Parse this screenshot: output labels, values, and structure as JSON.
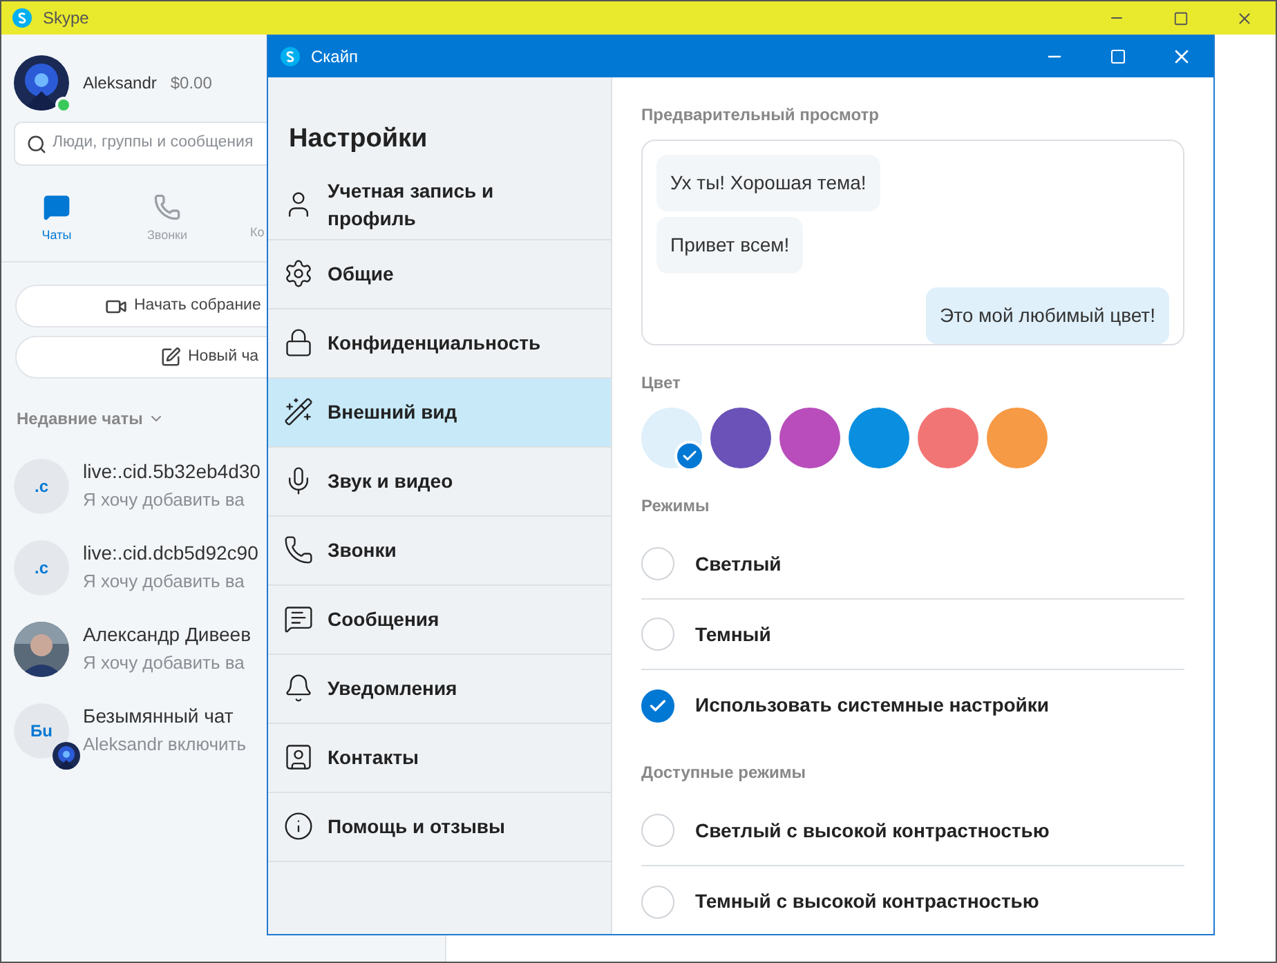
{
  "main_window": {
    "title": "Skype",
    "profile": {
      "name": "Aleksandr",
      "balance": "$0.00",
      "online": true
    },
    "search": {
      "placeholder": "Люди, группы и сообщения"
    },
    "tabs": [
      {
        "label": "Чаты",
        "selected": true
      },
      {
        "label": "Звонки",
        "selected": false
      },
      {
        "label": "Ко",
        "selected": false
      }
    ],
    "actions": [
      "Начать собрание",
      "Новый ча"
    ],
    "recent_header": "Недавние чаты",
    "chats": [
      {
        "kind": "initials",
        "initials": ".c",
        "name": "live:.cid.5b32eb4d30",
        "preview": "Я хочу добавить ва"
      },
      {
        "kind": "initials",
        "initials": ".c",
        "name": "live:.cid.dcb5d92c90",
        "preview": "Я хочу добавить ва"
      },
      {
        "kind": "picture",
        "name": "Александр Дивеев",
        "preview": "Я хочу добавить ва"
      },
      {
        "kind": "group",
        "initials": "Бu",
        "name": "Безымянный чат",
        "preview": "Aleksandr включить"
      }
    ]
  },
  "dialog": {
    "title": "Скайп",
    "heading": "Настройки",
    "nav": [
      {
        "label": "Учетная запись и профиль",
        "selected": false
      },
      {
        "label": "Общие",
        "selected": false
      },
      {
        "label": "Конфиденциальность",
        "selected": false
      },
      {
        "label": "Внешний вид",
        "selected": true
      },
      {
        "label": "Звук и видео",
        "selected": false
      },
      {
        "label": "Звонки",
        "selected": false
      },
      {
        "label": "Сообщения",
        "selected": false
      },
      {
        "label": "Уведомления",
        "selected": false
      },
      {
        "label": "Контакты",
        "selected": false
      },
      {
        "label": "Помощь и отзывы",
        "selected": false
      }
    ],
    "preview_header": "Предварительный просмотр",
    "messages": [
      {
        "text": "Ух ты! Хорошая тема!",
        "outgoing": false
      },
      {
        "text": "Привет всем!",
        "outgoing": false
      },
      {
        "text": "Это мой любимый цвет!",
        "outgoing": true
      }
    ],
    "color_header": "Цвет",
    "colors": [
      {
        "color": "#dff0fb",
        "selected": true
      },
      {
        "color": "#6a52b8",
        "selected": false
      },
      {
        "color": "#b94dbb",
        "selected": false
      },
      {
        "color": "#0a8fe0",
        "selected": false
      },
      {
        "color": "#f27575",
        "selected": false
      },
      {
        "color": "#f79a45",
        "selected": false
      }
    ],
    "modes_header": "Режимы",
    "modes": [
      {
        "label": "Светлый",
        "selected": false
      },
      {
        "label": "Темный",
        "selected": false
      },
      {
        "label": "Использовать системные настройки",
        "selected": true
      }
    ],
    "available_header": "Доступные режимы",
    "available_modes": [
      {
        "label": "Светлый с высокой контрастностью",
        "selected": false
      },
      {
        "label": "Темный с высокой контрастностью",
        "selected": false
      }
    ]
  }
}
